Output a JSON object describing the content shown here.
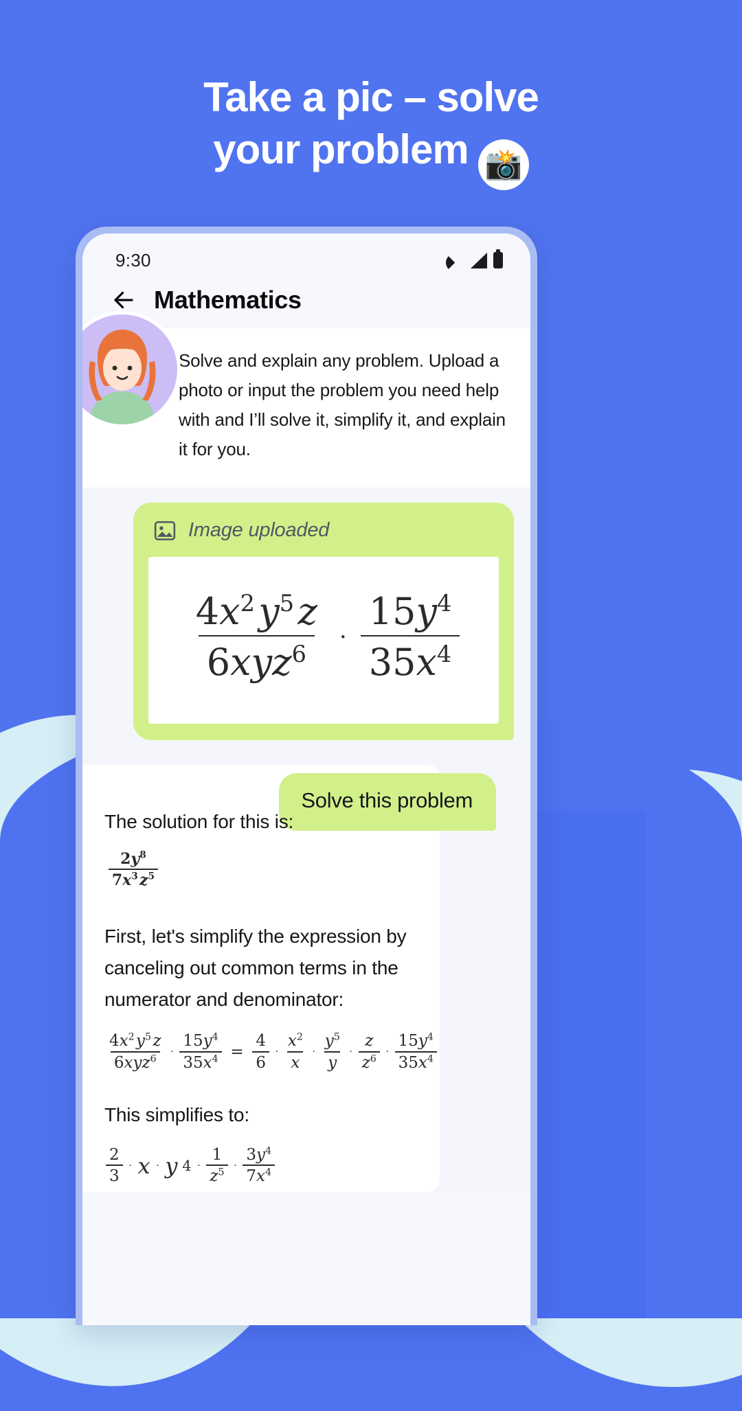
{
  "promo": {
    "headline_line1": "Take a pic – solve",
    "headline_line2": "your problem",
    "emoji": "📸",
    "background_color": "#4f72f0",
    "accent_green": "#d2f08a"
  },
  "status_bar": {
    "time": "9:30",
    "icons": [
      "wifi-icon",
      "signal-icon",
      "battery-icon"
    ]
  },
  "app_bar": {
    "back_icon": "back-arrow-icon",
    "title": "Mathematics"
  },
  "intro": {
    "avatar": "assistant-avatar",
    "text": "Solve and explain any problem. Upload a photo or input the problem you need help with and I’ll solve it, simplify it, and explain it for you."
  },
  "chat": {
    "image_upload_bubble": {
      "icon": "image-icon",
      "label": "Image uploaded",
      "formula": {
        "left": {
          "num": "4x²y⁵z",
          "den": "6xyz⁶"
        },
        "operator": "·",
        "right": {
          "num": "15y⁴",
          "den": "35x⁴"
        }
      }
    },
    "user_message": "Solve this problem",
    "bot": {
      "intro_line": "The solution for this is:",
      "answer": {
        "num": "2y⁸",
        "den": "7x³z⁵"
      },
      "explanation_1": "First, let's simplify the expression by canceling out common terms in the numerator and denominator:",
      "step_1": {
        "lhs_left": {
          "num": "4x²y⁵z",
          "den": "6xyz⁶"
        },
        "lhs_right": {
          "num": "15y⁴",
          "den": "35x⁴"
        },
        "equals": "=",
        "factors": [
          {
            "num": "4",
            "den": "6"
          },
          {
            "num": "x²",
            "den": "x"
          },
          {
            "num": "y⁵",
            "den": "y"
          },
          {
            "num": "z",
            "den": "z⁶"
          },
          {
            "num": "15y⁴",
            "den": "35x⁴"
          }
        ]
      },
      "explanation_2": "This simplifies to:",
      "step_2": {
        "terms": [
          "2/3",
          "x",
          "y⁴",
          "1/z⁵",
          "3y⁴/7x⁴"
        ]
      }
    }
  }
}
